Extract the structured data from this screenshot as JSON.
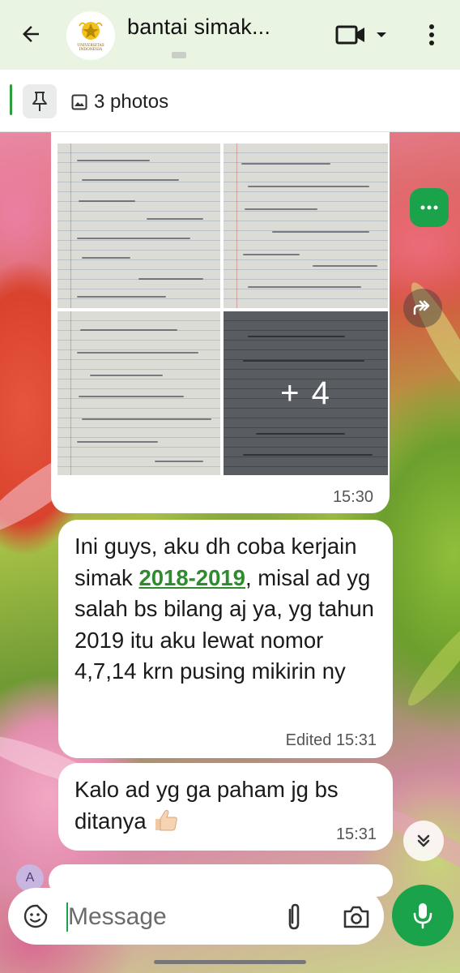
{
  "header": {
    "title": "bantai simak...",
    "avatar_text": "UNIVERSITAS INDONESIA",
    "icons": {
      "back": "arrow-left-icon",
      "video": "video-call-icon",
      "more": "more-vert-icon"
    }
  },
  "pinned": {
    "label": "3 photos",
    "icons": {
      "pin": "pin-icon",
      "photo": "image-icon"
    }
  },
  "messages": [
    {
      "type": "photo-grid",
      "more_count": "+ 4",
      "time": "15:30"
    },
    {
      "type": "text",
      "text_before": "Ini guys, aku dh coba kerjain simak ",
      "link": "2018-2019",
      "text_after": ", misal ad yg salah bs bilang aj ya, yg tahun 2019 itu aku lewat nomor 4,7,14 krn pusing mikirin ny",
      "edited_label": "Edited",
      "time": "15:31"
    },
    {
      "type": "text",
      "text": "Kalo ad yg ga paham jg bs ditanya",
      "emoji": "thumbs-up",
      "time": "15:31"
    }
  ],
  "next_sender_initial": "A",
  "composer": {
    "placeholder": "Message",
    "icons": {
      "emoji": "sticker-icon",
      "attach": "paperclip-icon",
      "camera": "camera-icon",
      "send": "mic-icon"
    }
  },
  "colors": {
    "accent": "#1aa34a",
    "header_bg": "#eaf4e2",
    "link": "#2e8b2e"
  }
}
